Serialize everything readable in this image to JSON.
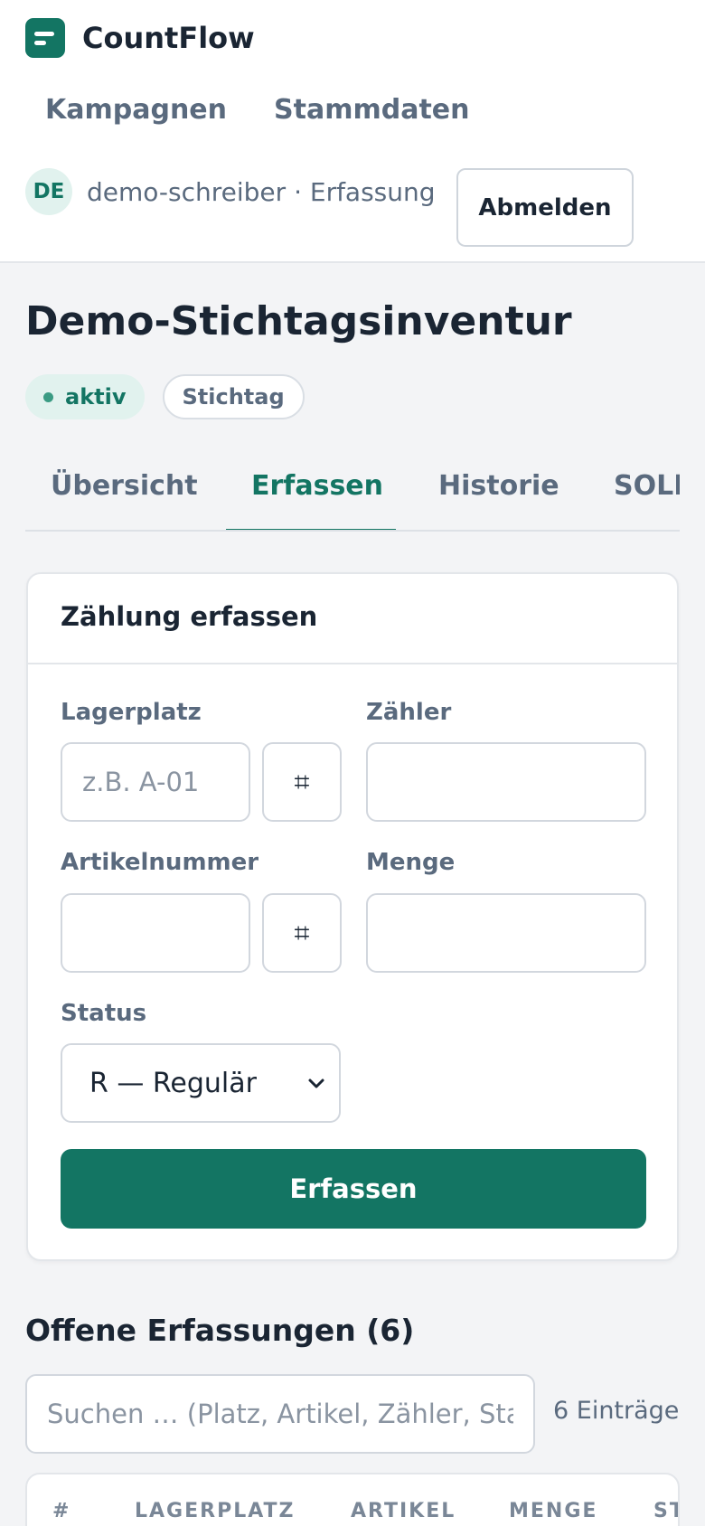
{
  "app": {
    "name": "CountFlow"
  },
  "nav": {
    "items": [
      "Kampagnen",
      "Stammdaten"
    ]
  },
  "user": {
    "initials": "DE",
    "text": "demo-schreiber · Erfassung",
    "logout_label": "Abmelden"
  },
  "page": {
    "title": "Demo-Stichtagsinventur",
    "status_badge": "aktiv",
    "type_badge": "Stichtag"
  },
  "tabs": [
    "Übersicht",
    "Erfassen",
    "Historie",
    "SOLL"
  ],
  "active_tab": "Erfassen",
  "form": {
    "title": "Zählung erfassen",
    "lagerplatz_label": "Lagerplatz",
    "lagerplatz_placeholder": "z.B. A-01",
    "scan_symbol": "⌗",
    "zaehler_label": "Zähler",
    "artikel_label": "Artikelnummer",
    "menge_label": "Menge",
    "status_label": "Status",
    "status_value": "R — Regulär",
    "submit_label": "Erfassen"
  },
  "open_entries": {
    "title": "Offene Erfassungen (6)",
    "search_placeholder": "Suchen … (Platz, Artikel, Zähler, Status)",
    "count_text": "6 Einträge",
    "columns": [
      "#",
      "LAGERPLATZ",
      "ARTIKEL",
      "MENGE",
      "STATUS"
    ]
  },
  "colors": {
    "accent": "#137563",
    "accent_light": "#e1f2ee",
    "text": "#1a2533",
    "muted": "#5a6a7e"
  },
  "icons": {
    "logo": "list-logo-icon",
    "scan": "hash-scan-icon",
    "select": "chevron-down-icon"
  }
}
